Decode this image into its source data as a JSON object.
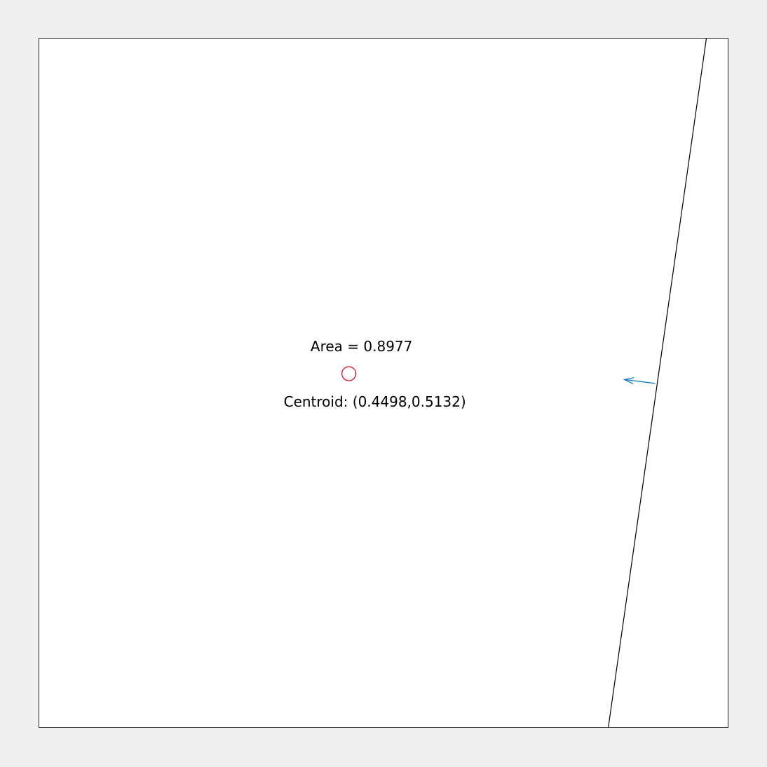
{
  "annotations": {
    "area_text": "Area = 0.8977",
    "centroid_text": "Centroid: (0.4498,0.5132)"
  },
  "domain": {
    "xlim": [
      0,
      1
    ],
    "ylim": [
      0,
      1
    ]
  },
  "cut_line": {
    "top": [
      0.9685,
      1.0
    ],
    "bottom": [
      0.8262,
      0.0
    ]
  },
  "normal_arrow": {
    "tail": [
      0.8942,
      0.4991
    ],
    "head": [
      0.8495,
      0.5047
    ]
  },
  "centroid": [
    0.4498,
    0.5132
  ],
  "colors": {
    "background": "#f0f0f0",
    "axes": "#ffffff",
    "line": "#000000",
    "arrow": "#0072bd",
    "centroid": "#e0001b"
  }
}
